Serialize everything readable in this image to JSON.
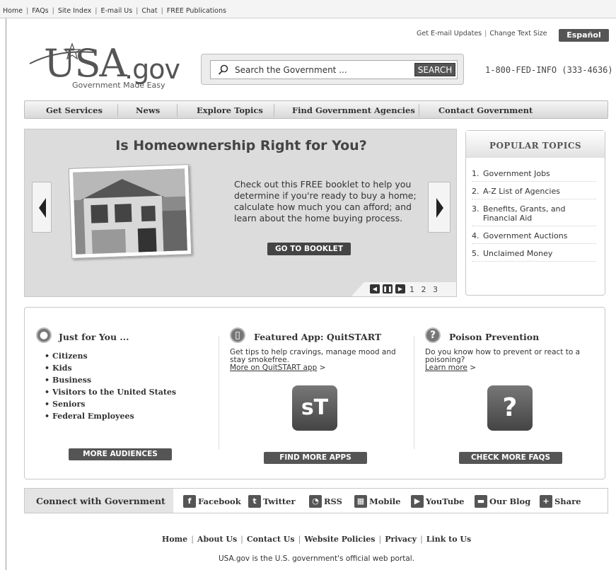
{
  "utility_bar": [
    "Home",
    "FAQs",
    "Site Index",
    "E-mail Us",
    "Chat",
    "FREE Publications"
  ],
  "header": {
    "email_updates": "Get E-mail Updates",
    "change_text": "Change Text Size",
    "espanol": "Español",
    "logo_main": "USA",
    "logo_gov": ".gov",
    "logo_tag": "Government Made Easy",
    "search_placeholder": "Search the Government ...",
    "search_button": "SEARCH",
    "phone": "1-800-FED-INFO (333-4636)"
  },
  "nav": [
    "Get Services",
    "News",
    "Explore Topics",
    "Find Government Agencies",
    "Contact Government"
  ],
  "hero": {
    "title": "Is Homeownership Right for You?",
    "text": "Check out this FREE booklet to help you determine if you're ready to buy a home; calculate how much you can afford; and learn about the home buying process.",
    "button": "GO TO BOOKLET",
    "pages": "1 2 3"
  },
  "popular": {
    "title": "POPULAR TOPICS",
    "items": [
      {
        "n": "1.",
        "label": "Government Jobs"
      },
      {
        "n": "2.",
        "label": "A-Z List of Agencies"
      },
      {
        "n": "3.",
        "label": "Benefits, Grants, and Financial Aid"
      },
      {
        "n": "4.",
        "label": "Government Auctions"
      },
      {
        "n": "5.",
        "label": "Unclaimed Money"
      }
    ]
  },
  "just_for_you": {
    "title": "Just for You ...",
    "items": [
      "Citizens",
      "Kids",
      "Business",
      "Visitors to the United States",
      "Seniors",
      "Federal Employees"
    ],
    "button": "MORE AUDIENCES"
  },
  "featured_app": {
    "title": "Featured App: QuitSTART",
    "text": "Get tips to help cravings, manage mood and stay smokefree.",
    "link": "More on QuitSTART app",
    "arrow": ">",
    "tile": "sT",
    "button": "FIND MORE APPS"
  },
  "poison": {
    "title": "Poison Prevention",
    "text": "Do you know how to prevent or react to a poisoning?",
    "link": "Learn more",
    "arrow": ">",
    "tile": "?",
    "button": "CHECK MORE FAQS"
  },
  "connect": {
    "label": "Connect with Government",
    "items": [
      "Facebook",
      "Twitter",
      "RSS",
      "Mobile",
      "YouTube",
      "Our Blog",
      "Share"
    ]
  },
  "footer": {
    "links": [
      "Home",
      "About Us",
      "Contact Us",
      "Website Policies",
      "Privacy",
      "Link to Us"
    ],
    "note": "USA.gov is the U.S. government's official web portal."
  }
}
